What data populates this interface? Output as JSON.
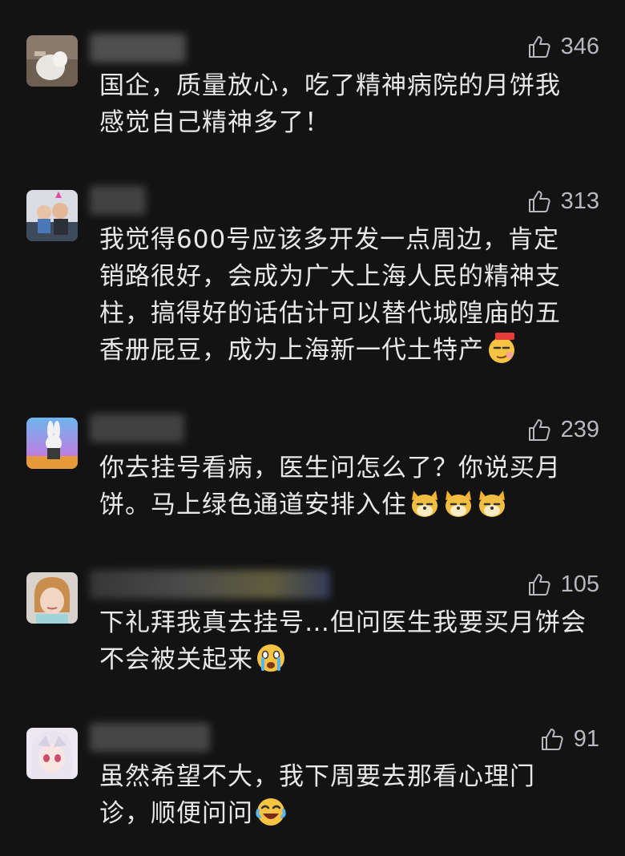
{
  "comments": [
    {
      "likes": "346",
      "lines": [
        "国企，质量放心，吃了精神病院的月饼我",
        "感觉自己精神多了！"
      ],
      "emojis": []
    },
    {
      "likes": "313",
      "lines": [
        "我觉得600号应该多开发一点周边，肯定",
        "销路很好，会成为广大上海人民的精神支",
        "柱，搞得好的话估计可以替代城隍庙的五",
        "香册屁豆，成为上海新一代土特产"
      ],
      "emojis": [
        "666-emoji"
      ]
    },
    {
      "likes": "239",
      "lines": [
        "你去挂号看病，医生问怎么了？你说买月",
        "饼。马上绿色通道安排入住"
      ],
      "emojis": [
        "doge-emoji",
        "doge-emoji",
        "doge-emoji"
      ]
    },
    {
      "likes": "105",
      "lines": [
        "下礼拜我真去挂号…但问医生我要买月饼会",
        "不会被关起来"
      ],
      "emojis": [
        "crying-emoji"
      ]
    },
    {
      "likes": "91",
      "lines": [
        "虽然希望不大，我下周要去那看心理门",
        "诊，顺便问问"
      ],
      "emojis": [
        "laughing-tears-emoji"
      ]
    }
  ],
  "icons": {
    "like": "thumbs-up-icon"
  },
  "colors": {
    "background": "#131313",
    "text": "#e8e8e8",
    "like": "#b7b9bf"
  }
}
